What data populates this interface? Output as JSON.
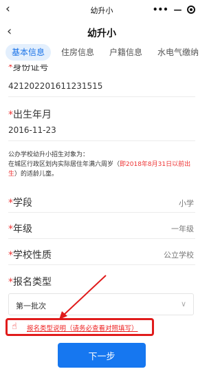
{
  "system": {
    "back_icon": "‹",
    "title": "幼升小",
    "more_icon": "•••",
    "minimize_icon": "—"
  },
  "nav": {
    "back_icon": "‹",
    "title": "幼升小"
  },
  "tabs": [
    {
      "label": "基本信息",
      "active": true
    },
    {
      "label": "住房信息",
      "active": false
    },
    {
      "label": "户籍信息",
      "active": false
    },
    {
      "label": "水电气缴纳",
      "active": false
    }
  ],
  "form": {
    "required_mark": "*",
    "id_label": "身份证号",
    "id_value": "421202201611231515",
    "birth_label": "出生年月",
    "birth_value": "2016-11-23",
    "notice_line1": "公办学校幼升小招生对象为：",
    "notice_line2_a": "在城区行政区划内实际居住年满六周岁（",
    "notice_line2_red": "即2018年8月31日以前出生",
    "notice_line2_b": "）的适龄儿童。",
    "stage_label": "学段",
    "stage_value": "小学",
    "grade_label": "年级",
    "grade_value": "一年级",
    "school_type_label": "学校性质",
    "school_type_value": "公立学校",
    "reg_type_label": "报名类型",
    "reg_type_value": "第一批次",
    "chevron_icon": "∨",
    "hand_icon": "☝",
    "explain_link": "报名类型说明（请务必查看对照填写）"
  },
  "next_button": "下一步",
  "colors": {
    "accent": "#1677f0",
    "required": "#e33333",
    "annotation": "#e01b1b"
  }
}
